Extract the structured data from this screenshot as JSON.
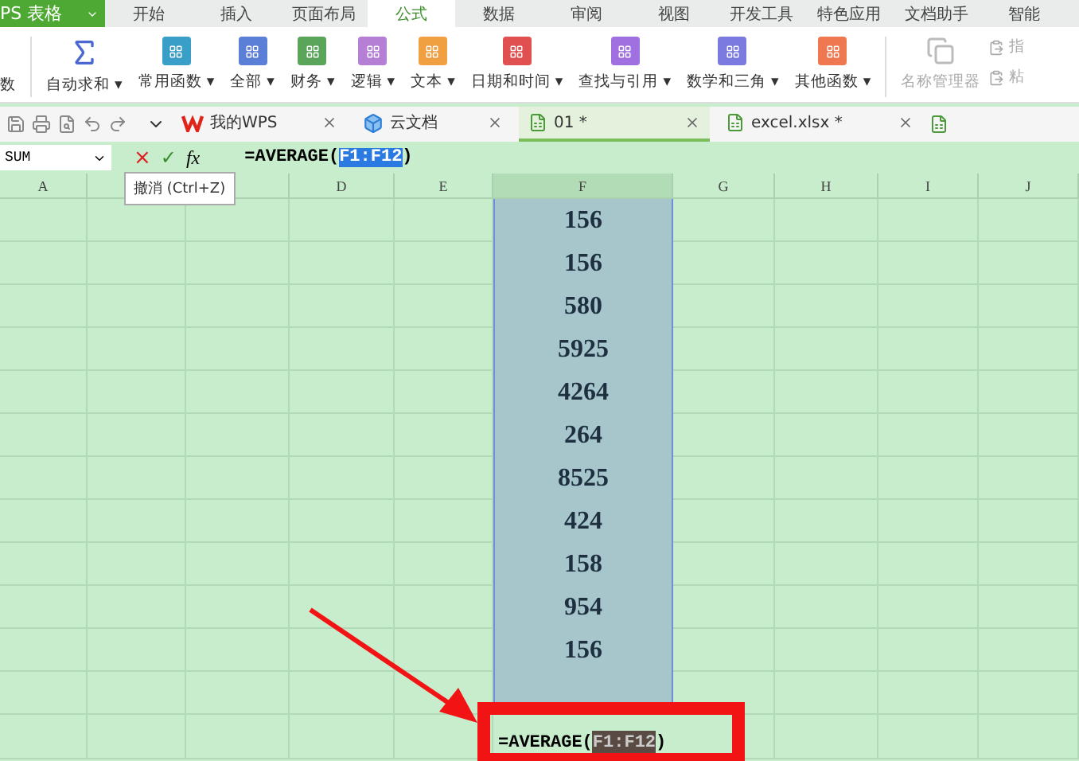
{
  "app_button": {
    "label": "PS 表格"
  },
  "menu_tabs": [
    {
      "label": "开始",
      "selected": false
    },
    {
      "label": "插入",
      "selected": false
    },
    {
      "label": "页面布局",
      "selected": false
    },
    {
      "label": "公式",
      "selected": true
    },
    {
      "label": "数据",
      "selected": false
    },
    {
      "label": "审阅",
      "selected": false
    },
    {
      "label": "视图",
      "selected": false
    },
    {
      "label": "开发工具",
      "selected": false
    },
    {
      "label": "特色应用",
      "selected": false
    },
    {
      "label": "文档助手",
      "selected": false
    },
    {
      "label": "智能",
      "selected": false
    }
  ],
  "ribbon": {
    "cut_label": "数",
    "items": [
      {
        "label": "自动求和",
        "caret": "▾",
        "kind": "sigma",
        "color": "#4a68d0"
      },
      {
        "label": "常用函数",
        "caret": "▾",
        "kind": "book",
        "color": "#3a9fc8"
      },
      {
        "label": "全部",
        "caret": "▾",
        "kind": "book",
        "color": "#5b7fd6"
      },
      {
        "label": "财务",
        "caret": "▾",
        "kind": "book",
        "color": "#5aa55a"
      },
      {
        "label": "逻辑",
        "caret": "▾",
        "kind": "book",
        "color": "#b57fd6"
      },
      {
        "label": "文本",
        "caret": "▾",
        "kind": "book",
        "color": "#f0a040"
      },
      {
        "label": "日期和时间",
        "caret": "▾",
        "kind": "book",
        "color": "#e05050"
      },
      {
        "label": "查找与引用",
        "caret": "▾",
        "kind": "book",
        "color": "#a070e0"
      },
      {
        "label": "数学和三角",
        "caret": "▾",
        "kind": "book",
        "color": "#7a7ae0"
      },
      {
        "label": "其他函数",
        "caret": "▾",
        "kind": "book",
        "color": "#f07850"
      }
    ],
    "name_manager": {
      "label": "名称管理器",
      "disabled": true
    },
    "small_buttons": [
      "指",
      "粘"
    ]
  },
  "doc_tabs": [
    {
      "label": "我的WPS",
      "kind": "wps",
      "selected": false
    },
    {
      "label": "云文档",
      "kind": "cloud",
      "selected": false
    },
    {
      "label": "01 *",
      "kind": "sheet",
      "selected": true
    },
    {
      "label": "excel.xlsx *",
      "kind": "sheet",
      "selected": false
    }
  ],
  "formula_bar": {
    "name_box": "SUM",
    "cancel": "×",
    "confirm": "✓",
    "fx": "fx",
    "formula": {
      "prefix": "=AVERAGE(",
      "highlight": "F1:F12",
      "suffix": ")"
    }
  },
  "tooltip": "撤消 (Ctrl+Z)",
  "columns": [
    {
      "label": "A",
      "selected": false
    },
    {
      "selected": false
    },
    {
      "selected": false
    },
    {
      "label": "D",
      "selected": false
    },
    {
      "label": "E",
      "selected": false
    },
    {
      "label": "F",
      "selected": true
    },
    {
      "label": "G",
      "selected": false
    },
    {
      "label": "H",
      "selected": false
    },
    {
      "label": "I",
      "selected": false
    },
    {
      "label": "J",
      "selected": false
    }
  ],
  "column_f_values": [
    "156",
    "156",
    "580",
    "5925",
    "4264",
    "264",
    "8525",
    "424",
    "158",
    "954",
    "156"
  ],
  "editing_cell": {
    "prefix": "=AVERAGE(",
    "highlight": "F1:F12",
    "suffix": ")"
  }
}
